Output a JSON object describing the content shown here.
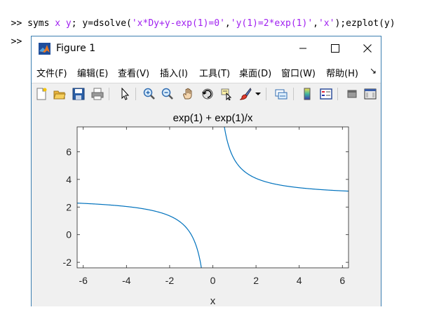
{
  "command_window": {
    "line1": {
      "prompt": ">>",
      "kw1": " syms ",
      "vars": "x y",
      "kw2": "; y=dsolve(",
      "arg1": "'x*Dy+y-exp(1)=0'",
      "comma1": ",",
      "arg2": "'y(1)=2*exp(1)'",
      "comma2": ",",
      "arg3": "'x'",
      "kw3": ");ezplot(y)"
    },
    "line2": {
      "prompt": ">>"
    }
  },
  "figure": {
    "title": "Figure 1",
    "menu": [
      "文件(F)",
      "编辑(E)",
      "查看(V)",
      "插入(I)",
      "工具(T)",
      "桌面(D)",
      "窗口(W)",
      "帮助(H)"
    ],
    "menu_more": "↘",
    "toolbar_icons": [
      "new-figure-icon",
      "open-file-icon",
      "save-icon",
      "print-icon",
      "pointer-icon",
      "zoom-in-icon",
      "zoom-out-icon",
      "pan-icon",
      "rotate-3d-icon",
      "data-cursor-icon",
      "brush-icon",
      "brush-dropdown-icon",
      "link-plot-icon",
      "colorbar-icon",
      "legend-icon",
      "hide-plot-tools-icon",
      "show-plot-tools-icon"
    ]
  },
  "chart_data": {
    "type": "line",
    "title": "exp(1) + exp(1)/x",
    "xlabel": "x",
    "ylabel": "",
    "xlim": [
      -6.2832,
      6.2832
    ],
    "ylim": [
      -2.4,
      7.8
    ],
    "xticks": [
      -6,
      -4,
      -2,
      0,
      2,
      4,
      6
    ],
    "yticks": [
      -2,
      0,
      2,
      4,
      6
    ],
    "grid": false,
    "line_color": "#0072bd",
    "series": [
      {
        "function": "exp(1) + exp(1)/x"
      }
    ]
  }
}
